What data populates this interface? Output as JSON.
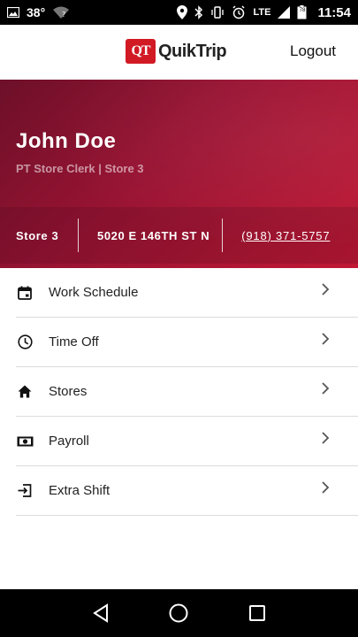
{
  "status_bar": {
    "temperature": "38°",
    "time": "11:54",
    "network": "LTE",
    "battery": "78"
  },
  "header": {
    "logo_mark": "QT",
    "logo_text": "QuikTrip",
    "logout_label": "Logout"
  },
  "profile": {
    "name": "John Doe",
    "role": "PT Store Clerk | Store 3",
    "store": "Store 3",
    "address": "5020 E 146TH ST N",
    "phone": "(918) 371-5757"
  },
  "menu": {
    "items": [
      {
        "label": "Work Schedule",
        "icon": "calendar-icon"
      },
      {
        "label": "Time Off",
        "icon": "clock-icon"
      },
      {
        "label": "Stores",
        "icon": "home-icon"
      },
      {
        "label": "Payroll",
        "icon": "money-icon"
      },
      {
        "label": "Extra Shift",
        "icon": "login-icon"
      }
    ]
  },
  "colors": {
    "brand_red": "#d11a24",
    "hero_start": "#6d1029",
    "hero_end": "#c01834"
  }
}
